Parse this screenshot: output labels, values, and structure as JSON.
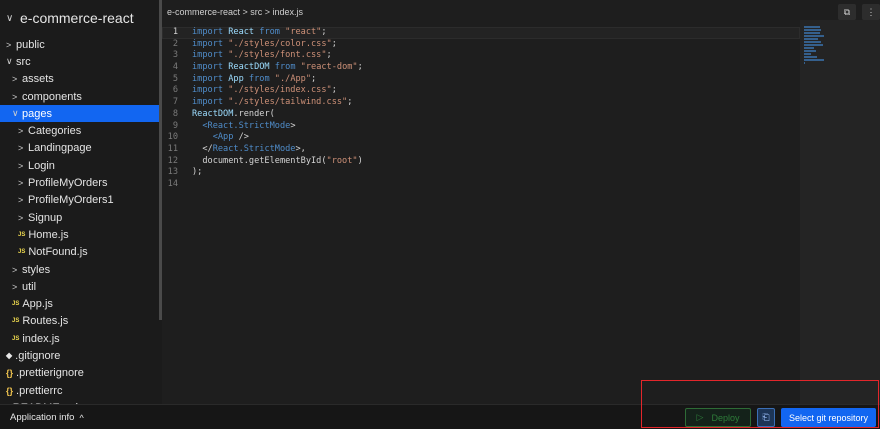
{
  "sidebar": {
    "root": "e-commerce-react",
    "items": [
      {
        "label": "public",
        "chevron": ">",
        "indent": 0,
        "type": "folder"
      },
      {
        "label": "src",
        "chevron": "∨",
        "indent": 0,
        "type": "folder"
      },
      {
        "label": "assets",
        "chevron": ">",
        "indent": 1,
        "type": "folder"
      },
      {
        "label": "components",
        "chevron": ">",
        "indent": 1,
        "type": "folder"
      },
      {
        "label": "pages",
        "chevron": "∨",
        "indent": 1,
        "type": "folder",
        "selected": true
      },
      {
        "label": "Categories",
        "chevron": ">",
        "indent": 2,
        "type": "folder"
      },
      {
        "label": "Landingpage",
        "chevron": ">",
        "indent": 2,
        "type": "folder"
      },
      {
        "label": "Login",
        "chevron": ">",
        "indent": 2,
        "type": "folder"
      },
      {
        "label": "ProfileMyOrders",
        "chevron": ">",
        "indent": 2,
        "type": "folder"
      },
      {
        "label": "ProfileMyOrders1",
        "chevron": ">",
        "indent": 2,
        "type": "folder"
      },
      {
        "label": "Signup",
        "chevron": ">",
        "indent": 2,
        "type": "folder"
      },
      {
        "label": "Home.js",
        "icon": "JS",
        "indent": 2,
        "type": "js"
      },
      {
        "label": "NotFound.js",
        "icon": "JS",
        "indent": 2,
        "type": "js"
      },
      {
        "label": "styles",
        "chevron": ">",
        "indent": 1,
        "type": "folder"
      },
      {
        "label": "util",
        "chevron": ">",
        "indent": 1,
        "type": "folder"
      },
      {
        "label": "App.js",
        "icon": "JS",
        "indent": 1,
        "type": "js"
      },
      {
        "label": "Routes.js",
        "icon": "JS",
        "indent": 1,
        "type": "js"
      },
      {
        "label": "index.js",
        "icon": "JS",
        "indent": 1,
        "type": "js"
      },
      {
        "label": ".gitignore",
        "icon": "◆",
        "indent": 0,
        "type": "git"
      },
      {
        "label": ".prettierignore",
        "icon": "{}",
        "indent": 0,
        "type": "brace"
      },
      {
        "label": ".prettierrc",
        "icon": "{}",
        "indent": 0,
        "type": "brace"
      },
      {
        "label": "README.md",
        "icon": "●",
        "indent": 0,
        "type": "md"
      }
    ]
  },
  "editor": {
    "breadcrumb": "e-commerce-react > src > index.js",
    "active_line": 1,
    "lines": [
      [
        [
          "kw",
          "import "
        ],
        [
          "id",
          "React "
        ],
        [
          "kw",
          "from "
        ],
        [
          "str",
          "\"react\""
        ],
        [
          "pl",
          ";"
        ]
      ],
      [
        [
          "kw",
          "import "
        ],
        [
          "str",
          "\"./styles/color.css\""
        ],
        [
          "pl",
          ";"
        ]
      ],
      [
        [
          "kw",
          "import "
        ],
        [
          "str",
          "\"./styles/font.css\""
        ],
        [
          "pl",
          ";"
        ]
      ],
      [
        [
          "kw",
          "import "
        ],
        [
          "id",
          "ReactDOM "
        ],
        [
          "kw",
          "from "
        ],
        [
          "str",
          "\"react-dom\""
        ],
        [
          "pl",
          ";"
        ]
      ],
      [
        [
          "kw",
          "import "
        ],
        [
          "id",
          "App "
        ],
        [
          "kw",
          "from "
        ],
        [
          "str",
          "\"./App\""
        ],
        [
          "pl",
          ";"
        ]
      ],
      [
        [
          "kw",
          "import "
        ],
        [
          "str",
          "\"./styles/index.css\""
        ],
        [
          "pl",
          ";"
        ]
      ],
      [
        [
          "kw",
          "import "
        ],
        [
          "str",
          "\"./styles/tailwind.css\""
        ],
        [
          "pl",
          ";"
        ]
      ],
      [
        [
          "id",
          "ReactDOM"
        ],
        [
          "pl",
          ".render("
        ]
      ],
      [
        [
          "pl",
          "  "
        ],
        [
          "tag",
          "<React.StrictMode"
        ],
        [
          "pl",
          ">"
        ]
      ],
      [
        [
          "pl",
          "    "
        ],
        [
          "tag",
          "<App "
        ],
        [
          "pl",
          "/>"
        ]
      ],
      [
        [
          "pl",
          "  </"
        ],
        [
          "tag",
          "React.StrictMode"
        ],
        [
          "pl",
          ">,"
        ]
      ],
      [
        [
          "pl",
          "  document.getElementById("
        ],
        [
          "str",
          "\"root\""
        ],
        [
          "pl",
          ")"
        ]
      ],
      [
        [
          "pl",
          ");"
        ]
      ],
      []
    ]
  },
  "statusbar": {
    "app_info_label": "Application info",
    "app_info_icon": "^",
    "deploy_label": "Deploy",
    "deploy_icon": "▷",
    "folder_icon": "⎗",
    "git_label": "Select git repository"
  },
  "icons": {
    "root_chevron": "∨",
    "copy": "⧉",
    "more": "⋮"
  }
}
